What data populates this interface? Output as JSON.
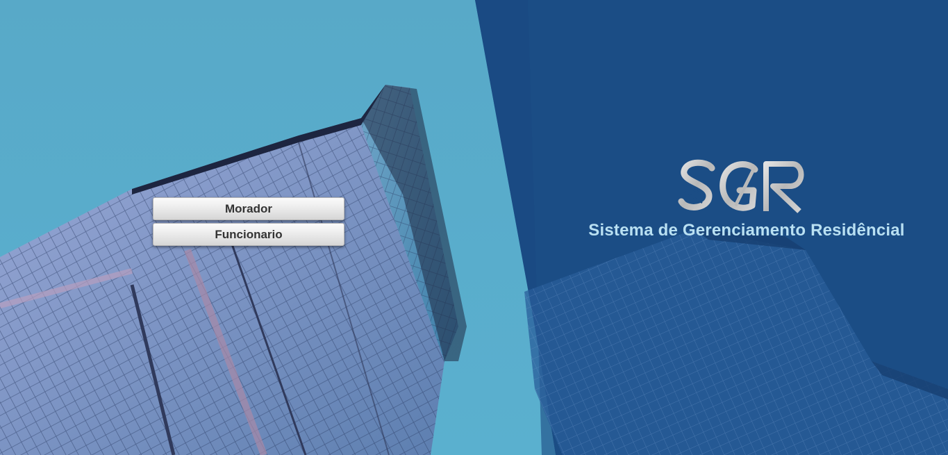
{
  "login_choice": {
    "morador_label": "Morador",
    "funcionario_label": "Funcionario"
  },
  "brand": {
    "logo_text": "SGR",
    "subtitle": "Sistema de Gerenciamento Residêncial"
  },
  "colors": {
    "sky_left": "#56a8c9",
    "panel_right": "#1b4d85",
    "subtitle_text": "#b9e0f2",
    "button_text": "#333333"
  }
}
